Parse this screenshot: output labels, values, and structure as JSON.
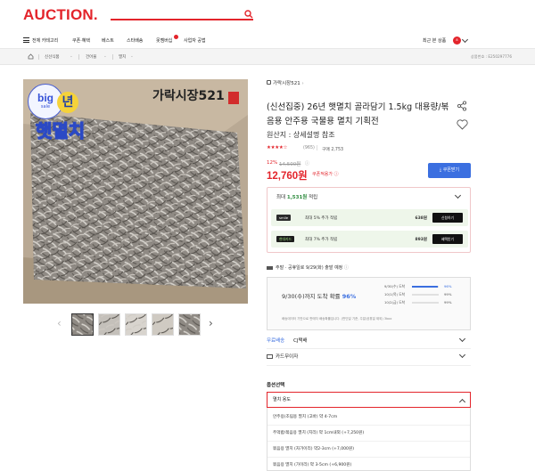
{
  "header": {
    "logo_text": "AUCTION.",
    "search_icon": "search-icon",
    "brand_color": "#e3242b"
  },
  "nav": {
    "menu_label": "전체 카테고리",
    "items": [
      "쿠폰·혜택",
      "베스트",
      "스타배송",
      "못멤버십",
      "사업자 공법"
    ],
    "recent_label": "최근 본 상품",
    "recent_count": "8"
  },
  "breadcrumb": {
    "items": [
      "신선식품",
      "건어물",
      "멸치"
    ],
    "product_no": "상품번호 : E250297776"
  },
  "product": {
    "image_overlay": {
      "badge_big": "big",
      "badge_sale": "sale",
      "brand_label": "가락시장521",
      "title_lines": [
        "햇",
        "년",
        "햇멸치"
      ]
    },
    "shop_name": "가락시장521",
    "title": "(신선집중) 26년 햇멸치 골라담기 1.5kg 대용량/볶음용 안주용 국물용 멸치 기획전",
    "origin": "원산지 : 상세설명 참조",
    "stars": "★★★★☆",
    "review_count": "(965)",
    "buy_count": "구매 2,753",
    "discount_rate": "12%",
    "original_price": "14,500원",
    "price": "12,760원",
    "price_note": "쿠폰적용가 ⓘ",
    "coupon_button": "⤓ 쿠폰받기"
  },
  "points": {
    "title_prefix": "최대",
    "title_amount": "1,531원",
    "title_suffix": "적립",
    "rows": [
      {
        "tag": "smile",
        "desc": "최대 5% 추가 적립",
        "amount": "638원",
        "button": "신청하기"
      },
      {
        "tag": "현대카드",
        "desc": "최대 7% 추가 적립",
        "amount": "893원",
        "button": "혜택받기"
      }
    ]
  },
  "shipping": {
    "header": "주말 · 공휴일로 9/29(화) 출발 예정",
    "main": "9/30(수)까지 도착 확률",
    "main_pct": "96%",
    "list": [
      {
        "label": "9/30(수) 도착",
        "pct": "96%",
        "fill": 96
      },
      {
        "label": "10/1(목) 도착",
        "pct": "99%",
        "fill": 0
      },
      {
        "label": "10/2(금) 도착",
        "pct": "99%",
        "fill": 0
      }
    ],
    "note": "배송데이터 기반으로 판매자 배송확률입니다. (판단일 기준, 주말/공휴일 제외) 3box"
  },
  "delivery": {
    "free_label": "무료배송",
    "carrier": "CJ택배",
    "payment_label": "카드무이자"
  },
  "options": {
    "title": "옵션선택",
    "selected": "멸치 용도",
    "list": [
      "안주용(조림용 멸치 (고바) 약 4-7cm",
      "주먹밥/볶음용 멸치 (지리) 약 1cm내외 (+7,250원)",
      "볶음용 멸치 (자가이리) 약2-3cm (+7,000원)",
      "볶음용 멸치 (가이리) 약 3-5cm (+6,900원)"
    ]
  }
}
